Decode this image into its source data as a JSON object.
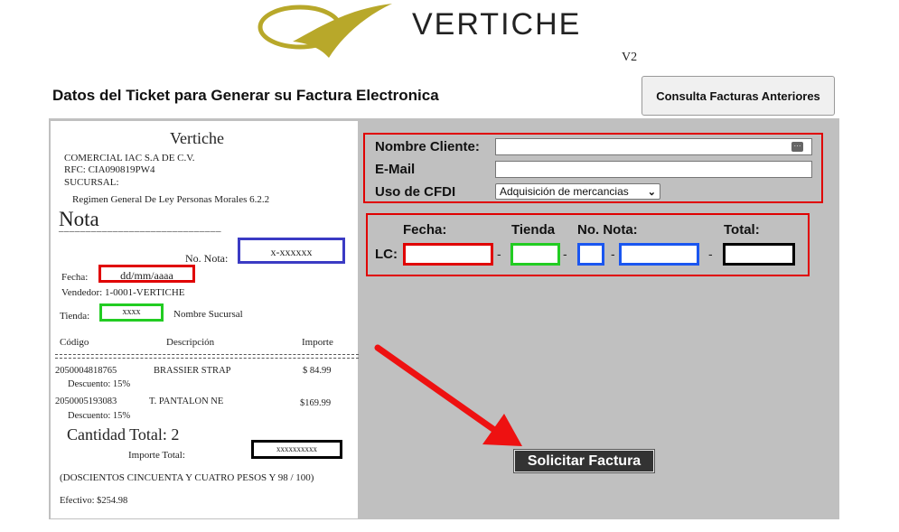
{
  "header": {
    "brand": "VERTICHE",
    "version": "V2"
  },
  "page_title": "Datos del Ticket para Generar su Factura Electronica",
  "prev_invoices_button": "Consulta Facturas Anteriores",
  "ticket": {
    "store_name": "Vertiche",
    "company": "COMERCIAL IAC S.A DE C.V.",
    "rfc": "RFC: CIA090819PW4",
    "branch": "SUCURSAL:",
    "regime": "Regimen General De Ley Personas Morales 6.2.2",
    "heading": "Nota",
    "divider": "______________________________",
    "no_nota_label": "No. Nota:",
    "no_nota_value": "x-xxxxxx",
    "fecha_label": "Fecha:",
    "fecha_value": "dd/mm/aaaa",
    "vendedor": "Vendedor: 1-0001-VERTICHE",
    "tienda_label": "Tienda:",
    "tienda_value": "xxxx",
    "tienda_name": "Nombre Sucursal",
    "col_codigo": "Código",
    "col_descripcion": "Descripción",
    "col_importe": "Importe",
    "items": [
      {
        "code": "2050004818765",
        "desc": "BRASSIER STRAP",
        "amount": "$ 84.99",
        "discount": "Descuento:  15%"
      },
      {
        "code": "2050005193083",
        "desc": "T. PANTALON NE",
        "amount": "$169.99",
        "discount": "Descuento:  15%"
      }
    ],
    "cantidad_total": "Cantidad Total: 2",
    "importe_total_label": "Importe Total:",
    "importe_total_value": "xxxxxxxxxx",
    "amount_words": "(DOSCIENTOS CINCUENTA Y CUATRO PESOS Y 98 / 100)",
    "efectivo": "Efectivo:  $254.98"
  },
  "form": {
    "nombre_label": "Nombre Cliente:",
    "nombre_value": "",
    "email_label": "E-Mail",
    "email_value": "",
    "cfdi_label": "Uso de CFDI",
    "cfdi_selected": "Adquisición de mercancias"
  },
  "lc": {
    "fecha_label": "Fecha:",
    "tienda_label": "Tienda",
    "nota_label": "No. Nota:",
    "total_label": "Total:",
    "lc_label": "LC:",
    "dash": "-"
  },
  "submit_button": "Solicitar Factura",
  "colors": {
    "fecha_box": "#e00000",
    "tienda_box": "#22cc22",
    "nota_box": "#1a56f0",
    "total_box": "#000000",
    "nota_ticket_box": "#3b3bc4",
    "arrow": "#ee1111"
  }
}
